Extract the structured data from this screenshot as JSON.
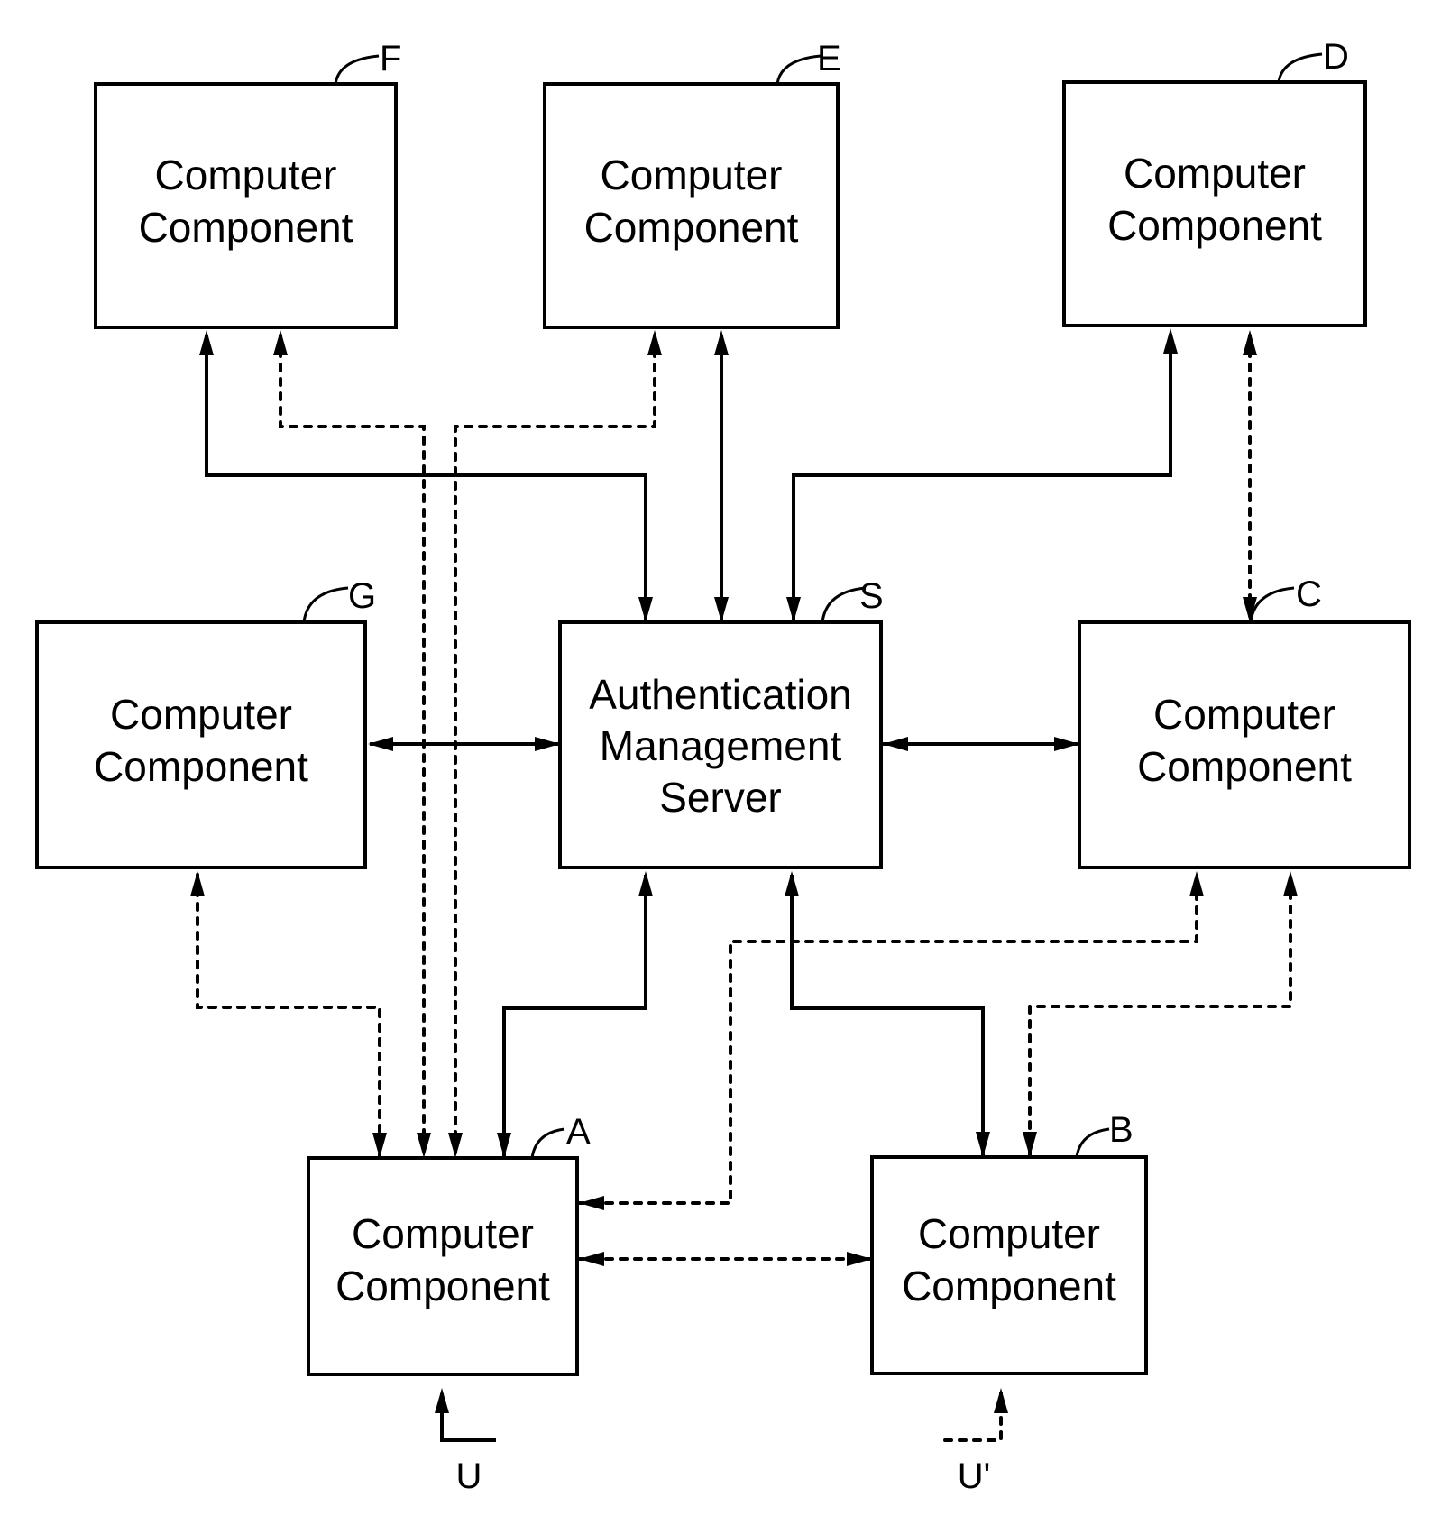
{
  "diagram": {
    "type": "network-block-diagram",
    "colors": {
      "line": "#000000",
      "background": "#ffffff"
    },
    "nodes": [
      {
        "id": "F",
        "ref": "F",
        "lines": [
          "Computer",
          "Component"
        ]
      },
      {
        "id": "E",
        "ref": "E",
        "lines": [
          "Computer",
          "Component"
        ]
      },
      {
        "id": "D",
        "ref": "D",
        "lines": [
          "Computer",
          "Component"
        ]
      },
      {
        "id": "G",
        "ref": "G",
        "lines": [
          "Computer",
          "Component"
        ]
      },
      {
        "id": "S",
        "ref": "S",
        "lines": [
          "Authentication",
          "Management",
          "Server"
        ]
      },
      {
        "id": "C",
        "ref": "C",
        "lines": [
          "Computer",
          "Component"
        ]
      },
      {
        "id": "A",
        "ref": "A",
        "lines": [
          "Computer",
          "Component"
        ]
      },
      {
        "id": "B",
        "ref": "B",
        "lines": [
          "Computer",
          "Component"
        ]
      }
    ],
    "edges": [
      {
        "from": "S",
        "to": "F",
        "style": "solid",
        "direction": "bidirectional"
      },
      {
        "from": "S",
        "to": "E",
        "style": "solid",
        "direction": "bidirectional"
      },
      {
        "from": "S",
        "to": "D",
        "style": "solid",
        "direction": "bidirectional"
      },
      {
        "from": "S",
        "to": "G",
        "style": "solid",
        "direction": "bidirectional"
      },
      {
        "from": "S",
        "to": "C",
        "style": "solid",
        "direction": "bidirectional"
      },
      {
        "from": "S",
        "to": "A",
        "style": "solid",
        "direction": "bidirectional"
      },
      {
        "from": "S",
        "to": "B",
        "style": "solid",
        "direction": "bidirectional"
      },
      {
        "from": "A",
        "to": "F",
        "style": "dotted",
        "direction": "bidirectional"
      },
      {
        "from": "A",
        "to": "E",
        "style": "dotted",
        "direction": "bidirectional"
      },
      {
        "from": "A",
        "to": "G",
        "style": "dotted",
        "direction": "bidirectional"
      },
      {
        "from": "A",
        "to": "C",
        "style": "dotted",
        "direction": "bidirectional"
      },
      {
        "from": "A",
        "to": "B",
        "style": "dotted",
        "direction": "bidirectional"
      },
      {
        "from": "B",
        "to": "C",
        "style": "dotted",
        "direction": "bidirectional"
      },
      {
        "from": "C",
        "to": "D",
        "style": "dotted",
        "direction": "bidirectional"
      }
    ],
    "users": [
      {
        "label": "U",
        "target": "A",
        "style": "solid"
      },
      {
        "label": "U'",
        "target": "B",
        "style": "dotted"
      }
    ]
  }
}
